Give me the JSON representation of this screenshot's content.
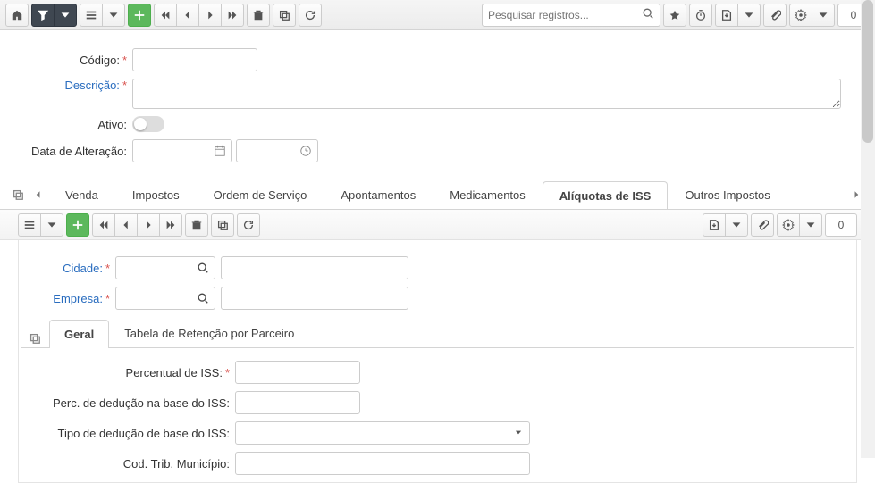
{
  "toolbar_top": {
    "search_placeholder": "Pesquisar registros...",
    "counter": "0"
  },
  "form": {
    "codigo_label": "Código:",
    "descricao_label": "Descrição:",
    "ativo_label": "Ativo:",
    "data_alteracao_label": "Data de Alteração:"
  },
  "main_tabs": {
    "items": [
      {
        "label": "Venda"
      },
      {
        "label": "Impostos"
      },
      {
        "label": "Ordem de Serviço"
      },
      {
        "label": "Apontamentos"
      },
      {
        "label": "Medicamentos"
      },
      {
        "label": "Alíquotas de ISS"
      },
      {
        "label": "Outros Impostos"
      }
    ],
    "active_index": 5
  },
  "sub_toolbar": {
    "counter": "0"
  },
  "sub_form": {
    "cidade_label": "Cidade:",
    "empresa_label": "Empresa:"
  },
  "inner_tabs": {
    "items": [
      {
        "label": "Geral"
      },
      {
        "label": "Tabela de Retenção por Parceiro"
      }
    ],
    "active_index": 0
  },
  "detail": {
    "perc_iss_label": "Percentual de ISS:",
    "perc_deducao_label": "Perc. de dedução na base do ISS:",
    "tipo_deducao_label": "Tipo de dedução de base do ISS:",
    "cod_trib_label": "Cod. Trib. Município:"
  }
}
